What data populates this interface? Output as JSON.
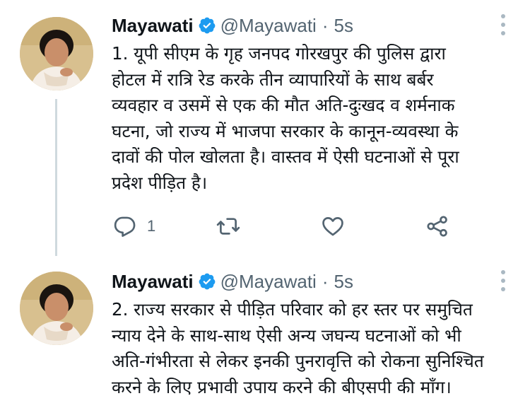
{
  "tweets": [
    {
      "name": "Mayawati",
      "handle": "@Mayawati",
      "separator": "·",
      "time": "5s",
      "text_lines": [
        "1. यूपी सीएम के गृह जनपद गोरखपुर की पुलिस द्वारा",
        "होटल में रात्रि रेड करके तीन व्यापारियों के साथ बर्बर",
        "व्यवहार व उसमें से एक की मौत अति-दुःखद व शर्मनाक",
        "घटना, जो राज्य में भाजपा सरकार के कानून-व्यवस्था के",
        "दावों की पोल खोलता है। वास्तव में ऐसी घटनाओं से पूरा",
        "प्रदेश पीड़ित है।"
      ],
      "reply_count": "1"
    },
    {
      "name": "Mayawati",
      "handle": "@Mayawati",
      "separator": "·",
      "time": "5s",
      "text_lines": [
        "2. राज्य सरकार से पीड़ित परिवार को हर स्तर पर समुचित",
        "न्याय देने के साथ-साथ ऐसी अन्य जघन्य घटनाओं को भी",
        "अति-गंभीरता से लेकर इनकी पुनरावृत्ति को रोकना सुनिश्चित",
        "करने के लिए प्रभावी उपाय करने की बीएसपी की माँग।"
      ]
    }
  ],
  "icons": {
    "verified": "verified-badge-icon",
    "more": "more-options-icon",
    "reply": "reply-icon",
    "retweet": "retweet-icon",
    "like": "like-icon",
    "share": "share-icon"
  },
  "colors": {
    "accent": "#1d9bf0",
    "text": "#0f1419",
    "secondary": "#536471",
    "thread_line": "#cfd9de"
  }
}
